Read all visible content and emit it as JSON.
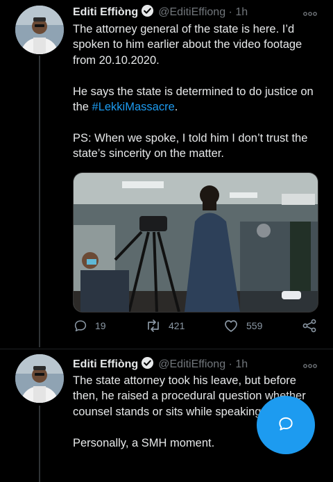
{
  "tweets": [
    {
      "author_name": "Editi Effiòng",
      "handle": "@EditiEffiong",
      "separator": "·",
      "time": "1h",
      "paragraphs": [
        {
          "text": "The attorney general of the state is here. I’d spoken to him earlier about the video footage from 20.10.2020."
        },
        {
          "before": "He says the state is determined to do justice on the ",
          "link": "#LekkiMassacre",
          "after": "."
        },
        {
          "text": "PS: When we spoke, I told him I don’t trust the state’s sincerity on the matter."
        }
      ],
      "actions": {
        "replies": "19",
        "retweets": "421",
        "likes": "559"
      }
    },
    {
      "author_name": "Editi Effiòng",
      "handle": "@EditiEffiong",
      "separator": "·",
      "time": "1h",
      "paragraphs": [
        {
          "text": "The state attorney took his leave, but before then, he raised a procedural question whether counsel stands or sits while speaking."
        },
        {
          "text": "Personally, a SMH moment."
        }
      ]
    }
  ],
  "icons": {
    "reply": "reply-icon",
    "retweet": "retweet-icon",
    "like": "heart-icon",
    "share": "share-icon",
    "compose": "compose-reply-icon",
    "verified": "verified-badge-icon",
    "more": "more-options-icon"
  },
  "colors": {
    "background": "#000000",
    "text": "#e7e9ea",
    "muted": "#71767b",
    "link": "#1d9bf0",
    "accent": "#1d9bf0"
  }
}
